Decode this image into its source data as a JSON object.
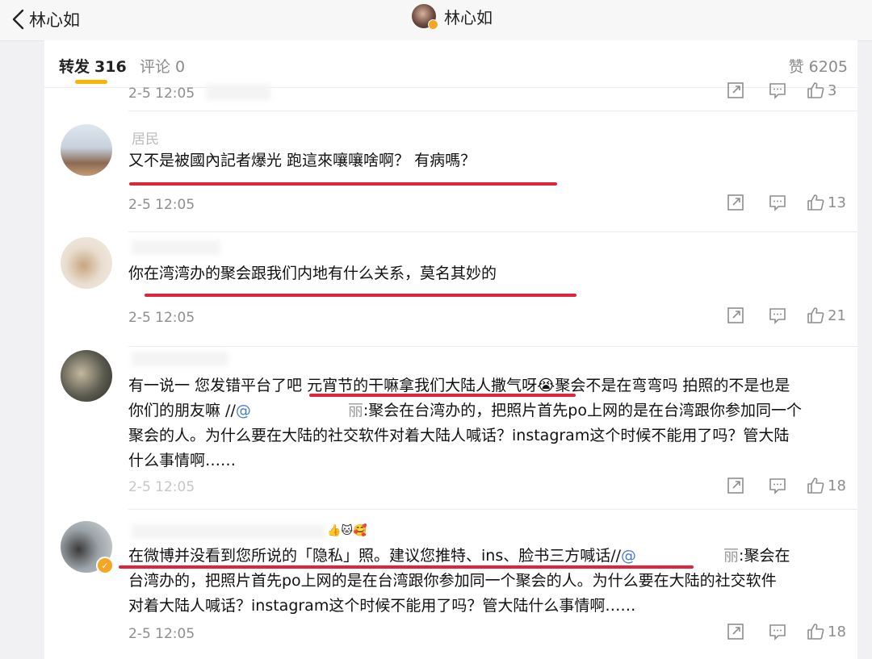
{
  "header": {
    "back_label": "林心如",
    "title": "林心如"
  },
  "tabs": {
    "repost_label": "转发",
    "repost_count": "316",
    "comment_label": "评论",
    "comment_count": "0",
    "likes_label": "赞",
    "likes_count": "6205"
  },
  "posts": [
    {
      "time": "2-5 12:05",
      "text": "",
      "likes": "3",
      "name": ""
    },
    {
      "name": "居民",
      "text": "又不是被國內記者爆光 跑這來嚷嚷啥啊？ 有病嗎？",
      "time": "2-5 12:05",
      "likes": "13"
    },
    {
      "name": "",
      "text": "你在湾湾办的聚会跟我们内地有什么关系，莫名其妙的",
      "time": "2-5 12:05",
      "likes": "21"
    },
    {
      "name": "",
      "line1a": "有一说一 您发错平台了吧 ",
      "line1b": "元宵节的干嘛拿我们大陆人撒气呀",
      "emoji1": "😭",
      "line1c": "聚会不是在弯弯吗 拍照的不是也是",
      "line2a": "你们的朋友嘛 //",
      "mention": "@",
      "line2b": "丽",
      "line2c": ":聚会在台湾办的，把照片首先po上网的是在台湾跟你参加同一个",
      "line3": "聚会的人。为什么要在大陆的社交软件对着大陆人喊话？instagram这个时候不能用了吗？管大陆",
      "line4": "什么事情啊……",
      "time": "2-5 12:05",
      "likes": "18"
    },
    {
      "name": "",
      "emoji": "👍🐱🥰",
      "line1a": "在微博并没看到您所说的「隐私」照。建议您推特、ins、脸书三方喊话//",
      "mention": "@",
      "line1b": "丽",
      "line1c": ":聚会在",
      "line2": "台湾办的，把照片首先po上网的是在台湾跟你参加同一个聚会的人。为什么要在大陆的社交软件",
      "line3": "对着大陆人喊话？instagram这个时候不能用了吗？管大陆什么事情啊……",
      "time": "2-5 12:05",
      "likes": "18"
    }
  ],
  "colors": {
    "accent_underline": "#f7b500",
    "highlight_red": "#e0243c",
    "verified_badge": "#f5a623",
    "link_blue": "#4a7dc9"
  },
  "icons": [
    "chevron-left-icon",
    "share-icon",
    "comment-icon",
    "like-icon",
    "verified-badge-icon"
  ]
}
